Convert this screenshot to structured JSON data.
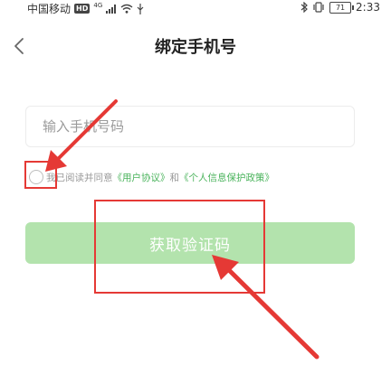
{
  "status_bar": {
    "carrier": "中国移动",
    "hd": "HD",
    "network": "4G",
    "battery": "71",
    "time": "2:33"
  },
  "header": {
    "title": "绑定手机号"
  },
  "form": {
    "phone_placeholder": "输入手机号码",
    "agreement_prefix": "我已阅读并同意",
    "user_agreement_link": "《用户协议》",
    "conjunction": "和",
    "privacy_policy_link": "《个人信息保护政策》",
    "get_code_label": "获取验证码"
  },
  "colors": {
    "accent_green": "#49b35b",
    "button_disabled_green": "#b3e3ad",
    "annotation_red": "#e53935"
  }
}
